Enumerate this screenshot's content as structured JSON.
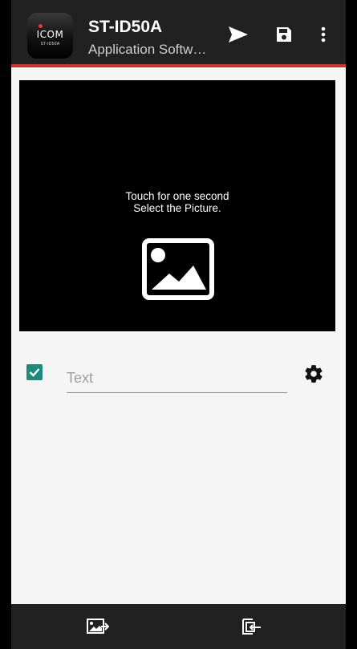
{
  "app": {
    "logo_text": "ICOM",
    "logo_sub": "ST-ID50A",
    "title": "ST-ID50A",
    "subtitle": "Application Softw…"
  },
  "toolbar": {
    "actions": [
      "send-icon",
      "save-icon",
      "more-vert-icon"
    ]
  },
  "preview": {
    "hint_line1": "Touch for one second",
    "hint_line2": "Select the Picture."
  },
  "text_option": {
    "checked": true,
    "placeholder": "Text"
  },
  "bottom_nav": {
    "icons": [
      "import-picture-icon",
      "copy-export-icon"
    ]
  },
  "colors": {
    "appbar": "#212121",
    "accent": "#d32f2f",
    "checkbox": "#1e8a7a",
    "background": "#f5f5f5"
  }
}
